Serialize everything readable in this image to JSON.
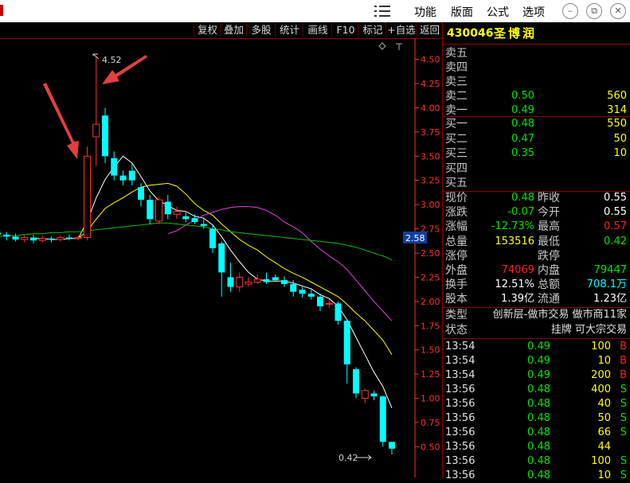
{
  "titlebar": {
    "menus": [
      "功能",
      "版面",
      "公式",
      "选项"
    ],
    "window_buttons": [
      "minimize",
      "restore",
      "close"
    ]
  },
  "toolbar": [
    "复权",
    "叠加",
    "多股",
    "统计",
    "画线",
    "F10",
    "标记",
    "+自选",
    "返回"
  ],
  "stock": {
    "code": "430046",
    "name": "圣博润"
  },
  "price_axis": {
    "labels": [
      "4.50",
      "4.25",
      "4.00",
      "3.75",
      "3.50",
      "3.25",
      "3.00",
      "2.75",
      "2.50",
      "2.25",
      "2.00",
      "1.75",
      "1.50",
      "1.25",
      "1.00",
      "0.75",
      "0.50"
    ],
    "current_marker": "2.58"
  },
  "chart_annotations": {
    "high_label": "4.52",
    "low_label": "0.42"
  },
  "chart_data": {
    "type": "candlestick",
    "ylim": [
      0.38,
      4.62
    ],
    "candles": [
      {
        "o": 2.71,
        "c": 2.69,
        "h": 2.74,
        "l": 2.66
      },
      {
        "o": 2.69,
        "c": 2.67,
        "h": 2.72,
        "l": 2.63
      },
      {
        "o": 2.67,
        "c": 2.64,
        "h": 2.7,
        "l": 2.62
      },
      {
        "o": 2.64,
        "c": 2.66,
        "h": 2.68,
        "l": 2.61
      },
      {
        "o": 2.66,
        "c": 2.63,
        "h": 2.69,
        "l": 2.6
      },
      {
        "o": 2.63,
        "c": 2.65,
        "h": 2.68,
        "l": 2.61
      },
      {
        "o": 2.65,
        "c": 2.64,
        "h": 2.67,
        "l": 2.61
      },
      {
        "o": 2.64,
        "c": 2.66,
        "h": 2.68,
        "l": 2.62
      },
      {
        "o": 2.66,
        "c": 2.65,
        "h": 2.69,
        "l": 2.63
      },
      {
        "o": 2.65,
        "c": 2.66,
        "h": 2.68,
        "l": 2.63
      },
      {
        "o": 2.66,
        "c": 3.5,
        "h": 3.6,
        "l": 2.63
      },
      {
        "o": 3.7,
        "c": 3.83,
        "h": 4.52,
        "l": 3.4
      },
      {
        "o": 3.92,
        "c": 3.5,
        "h": 4.0,
        "l": 3.43
      },
      {
        "o": 3.48,
        "c": 3.3,
        "h": 3.55,
        "l": 3.25
      },
      {
        "o": 3.3,
        "c": 3.25,
        "h": 3.35,
        "l": 3.2
      },
      {
        "o": 3.35,
        "c": 3.25,
        "h": 3.42,
        "l": 3.2
      },
      {
        "o": 3.18,
        "c": 3.05,
        "h": 3.22,
        "l": 2.98
      },
      {
        "o": 3.05,
        "c": 2.85,
        "h": 3.1,
        "l": 2.8
      },
      {
        "o": 2.83,
        "c": 3.05,
        "h": 3.08,
        "l": 2.8
      },
      {
        "o": 3.03,
        "c": 2.9,
        "h": 3.1,
        "l": 2.85
      },
      {
        "o": 2.9,
        "c": 2.93,
        "h": 2.98,
        "l": 2.85
      },
      {
        "o": 2.88,
        "c": 2.85,
        "h": 2.92,
        "l": 2.82
      },
      {
        "o": 2.86,
        "c": 2.82,
        "h": 2.9,
        "l": 2.8
      },
      {
        "o": 2.8,
        "c": 2.78,
        "h": 2.85,
        "l": 2.75
      },
      {
        "o": 2.75,
        "c": 2.55,
        "h": 2.8,
        "l": 2.5
      },
      {
        "o": 2.6,
        "c": 2.3,
        "h": 2.62,
        "l": 2.05
      },
      {
        "o": 2.25,
        "c": 2.15,
        "h": 2.4,
        "l": 2.1
      },
      {
        "o": 2.15,
        "c": 2.25,
        "h": 2.3,
        "l": 2.1
      },
      {
        "o": 2.18,
        "c": 2.2,
        "h": 2.25,
        "l": 2.15
      },
      {
        "o": 2.2,
        "c": 2.23,
        "h": 2.28,
        "l": 2.18
      },
      {
        "o": 2.23,
        "c": 2.2,
        "h": 2.3,
        "l": 2.18
      },
      {
        "o": 2.25,
        "c": 2.22,
        "h": 2.28,
        "l": 2.2
      },
      {
        "o": 2.22,
        "c": 2.18,
        "h": 2.26,
        "l": 2.15
      },
      {
        "o": 2.18,
        "c": 2.1,
        "h": 2.22,
        "l": 2.05
      },
      {
        "o": 2.12,
        "c": 2.08,
        "h": 2.15,
        "l": 2.04
      },
      {
        "o": 2.08,
        "c": 2.05,
        "h": 2.12,
        "l": 2.02
      },
      {
        "o": 2.05,
        "c": 1.95,
        "h": 2.08,
        "l": 1.9
      },
      {
        "o": 1.98,
        "c": 1.98,
        "h": 2.02,
        "l": 1.94
      },
      {
        "o": 1.98,
        "c": 1.8,
        "h": 2.0,
        "l": 1.76
      },
      {
        "o": 1.8,
        "c": 1.35,
        "h": 1.82,
        "l": 1.15
      },
      {
        "o": 1.3,
        "c": 1.05,
        "h": 1.32,
        "l": 1.0
      },
      {
        "o": 1.0,
        "c": 1.08,
        "h": 1.1,
        "l": 0.95
      },
      {
        "o": 1.05,
        "c": 1.02,
        "h": 1.08,
        "l": 0.98
      },
      {
        "o": 1.02,
        "c": 0.55,
        "h": 1.03,
        "l": 0.5
      },
      {
        "o": 0.55,
        "c": 0.48,
        "h": 0.55,
        "l": 0.42
      }
    ],
    "ma_series": [
      {
        "color": "#ffffff",
        "values": [
          null,
          null,
          null,
          null,
          2.65,
          2.65,
          2.64,
          2.64,
          2.65,
          2.65,
          2.83,
          3.07,
          3.26,
          3.39,
          3.5,
          3.43,
          3.29,
          3.14,
          3.04,
          2.99,
          2.94,
          2.93,
          2.88,
          2.86,
          2.79,
          2.67,
          2.53,
          2.41,
          2.3,
          2.23,
          2.21,
          2.21,
          2.21,
          2.19,
          2.16,
          2.13,
          2.07,
          2.03,
          1.95,
          1.81,
          1.63,
          1.45,
          1.27,
          1.12,
          0.9
        ]
      },
      {
        "color": "#ffff00",
        "values": [
          null,
          null,
          null,
          null,
          null,
          null,
          null,
          null,
          null,
          2.65,
          2.73,
          2.85,
          2.96,
          3.02,
          3.07,
          3.13,
          3.18,
          3.2,
          3.21,
          3.22,
          3.19,
          3.11,
          3.01,
          2.94,
          2.89,
          2.8,
          2.72,
          2.64,
          2.58,
          2.53,
          2.46,
          2.4,
          2.34,
          2.29,
          2.25,
          2.2,
          2.15,
          2.1,
          2.05,
          1.97,
          1.88,
          1.8,
          1.7,
          1.6,
          1.45
        ]
      },
      {
        "color": "#e040e0",
        "values": [
          null,
          null,
          null,
          null,
          null,
          null,
          null,
          null,
          null,
          null,
          null,
          null,
          null,
          null,
          null,
          null,
          null,
          null,
          null,
          2.7,
          2.73,
          2.79,
          2.84,
          2.89,
          2.92,
          2.95,
          2.97,
          2.98,
          2.98,
          2.97,
          2.94,
          2.89,
          2.82,
          2.77,
          2.71,
          2.62,
          2.54,
          2.47,
          2.41,
          2.33,
          2.22,
          2.11,
          2.0,
          1.9,
          1.8
        ]
      },
      {
        "color": "#00c000",
        "values": [
          2.67,
          2.68,
          2.68,
          2.69,
          2.7,
          2.7,
          2.71,
          2.71,
          2.72,
          2.72,
          2.73,
          2.74,
          2.75,
          2.76,
          2.77,
          2.78,
          2.79,
          2.8,
          2.81,
          2.81,
          2.8,
          2.79,
          2.78,
          2.77,
          2.75,
          2.74,
          2.72,
          2.71,
          2.7,
          2.69,
          2.68,
          2.67,
          2.66,
          2.65,
          2.64,
          2.63,
          2.62,
          2.61,
          2.6,
          2.58,
          2.56,
          2.53,
          2.5,
          2.47,
          2.43
        ]
      }
    ]
  },
  "order_book": {
    "sell": [
      {
        "label": "卖五",
        "price": "",
        "vol": ""
      },
      {
        "label": "卖四",
        "price": "",
        "vol": ""
      },
      {
        "label": "卖三",
        "price": "",
        "vol": ""
      },
      {
        "label": "卖二",
        "price": "0.50",
        "vol": "560"
      },
      {
        "label": "卖一",
        "price": "0.49",
        "vol": "314"
      }
    ],
    "buy": [
      {
        "label": "买一",
        "price": "0.48",
        "vol": "550"
      },
      {
        "label": "买二",
        "price": "0.47",
        "vol": "50"
      },
      {
        "label": "买三",
        "price": "0.35",
        "vol": "10"
      },
      {
        "label": "买四",
        "price": "",
        "vol": ""
      },
      {
        "label": "买五",
        "price": "",
        "vol": ""
      }
    ]
  },
  "quote": [
    {
      "l1": "现价",
      "v1": "0.48",
      "c1": "g",
      "l2": "昨收",
      "v2": "0.55",
      "c2": "w"
    },
    {
      "l1": "涨跌",
      "v1": "-0.07",
      "c1": "g",
      "l2": "今开",
      "v2": "0.55",
      "c2": "w"
    },
    {
      "l1": "涨幅",
      "v1": "-12.73%",
      "c1": "g",
      "l2": "最高",
      "v2": "0.57",
      "c2": "r"
    },
    {
      "l1": "总量",
      "v1": "153516",
      "c1": "y",
      "l2": "最低",
      "v2": "0.42",
      "c2": "g"
    },
    {
      "l1": "涨停",
      "v1": "",
      "c1": "w",
      "l2": "跌停",
      "v2": "",
      "c2": "w"
    },
    {
      "l1": "外盘",
      "v1": "74069",
      "c1": "r",
      "l2": "内盘",
      "v2": "79447",
      "c2": "g"
    },
    {
      "l1": "换手",
      "v1": "12.51%",
      "c1": "w",
      "l2": "总额",
      "v2": "708.1万",
      "c2": "c"
    },
    {
      "l1": "股本",
      "v1": "1.39亿",
      "c1": "w",
      "l2": "流通",
      "v2": "1.23亿",
      "c2": "w"
    }
  ],
  "info": [
    {
      "label": "类型",
      "value": "创新层-做市交易 做市商11家"
    },
    {
      "label": "状态",
      "value": "挂牌 可大宗交易"
    }
  ],
  "ticks": [
    {
      "time": "13:54",
      "price": "0.49",
      "vol": "100",
      "side": "B"
    },
    {
      "time": "13:54",
      "price": "0.49",
      "vol": "10",
      "side": "B"
    },
    {
      "time": "13:54",
      "price": "0.49",
      "vol": "200",
      "side": "B"
    },
    {
      "time": "13:56",
      "price": "0.48",
      "vol": "400",
      "side": "S"
    },
    {
      "time": "13:56",
      "price": "0.48",
      "vol": "40",
      "side": "S"
    },
    {
      "time": "13:56",
      "price": "0.48",
      "vol": "50",
      "side": "S"
    },
    {
      "time": "13:56",
      "price": "0.48",
      "vol": "66",
      "side": "S"
    },
    {
      "time": "13:56",
      "price": "0.48",
      "vol": "44",
      "side": ""
    },
    {
      "time": "13:56",
      "price": "0.48",
      "vol": "100",
      "side": "S"
    },
    {
      "time": "13:56",
      "price": "0.48",
      "vol": "10",
      "side": "S"
    }
  ],
  "colors": {
    "up": "#ff3030",
    "down": "#00ffff",
    "border": "#8b0000",
    "axis": "#ff3030"
  }
}
